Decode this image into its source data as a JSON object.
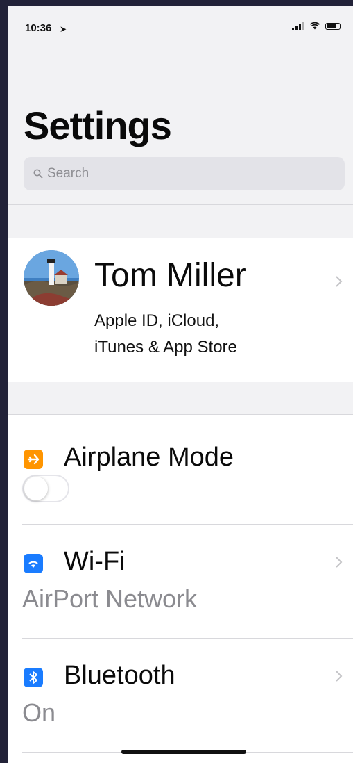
{
  "status_bar": {
    "time": "10:36"
  },
  "header": {
    "title": "Settings"
  },
  "search": {
    "placeholder": "Search"
  },
  "profile": {
    "name": "Tom Miller",
    "subtitle_line1": "Apple ID, iCloud,",
    "subtitle_line2": "iTunes & App Store"
  },
  "settings": [
    {
      "label": "Airplane Mode",
      "icon": "airplane-icon",
      "icon_color": "#ff9500",
      "toggle_on": false
    },
    {
      "label": "Wi-Fi",
      "icon": "wifi-icon",
      "icon_color": "#1a7cff",
      "value": "AirPort Network"
    },
    {
      "label": "Bluetooth",
      "icon": "bluetooth-icon",
      "icon_color": "#1a7cff",
      "value": "On"
    }
  ],
  "colors": {
    "accent_orange": "#ff9500",
    "accent_blue": "#1a7cff",
    "background": "#f2f2f4"
  }
}
